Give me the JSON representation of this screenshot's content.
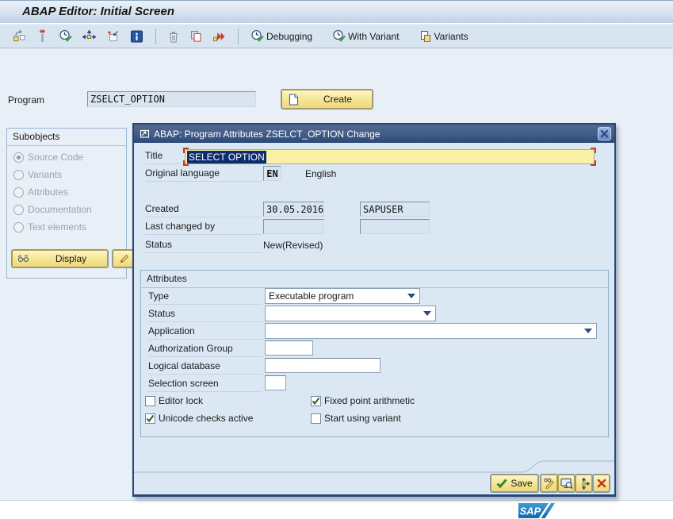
{
  "app": {
    "title": "ABAP Editor: Initial Screen"
  },
  "toolbar": {
    "debugging_label": "Debugging",
    "with_variant_label": "With Variant",
    "variants_label": "Variants",
    "icons": [
      "other-object-icon",
      "create-wand-icon",
      "execute-check-icon",
      "execute-with-icon",
      "insert-icon",
      "info-icon",
      "delete-icon",
      "copy-icon",
      "execute-program-icon",
      "clock-check-icon",
      "variants-icon"
    ]
  },
  "program": {
    "label": "Program",
    "value": "ZSELCT_OPTION",
    "create_label": "Create"
  },
  "subobjects": {
    "title": "Subobjects",
    "options": [
      {
        "label": "Source Code",
        "selected": true
      },
      {
        "label": "Variants",
        "selected": false
      },
      {
        "label": "Attributes",
        "selected": false
      },
      {
        "label": "Documentation",
        "selected": false
      },
      {
        "label": "Text elements",
        "selected": false
      }
    ],
    "display_label": "Display"
  },
  "dialog": {
    "title": "ABAP: Program Attributes ZSELCT_OPTION Change",
    "fields": {
      "title_label": "Title",
      "title_value": "SELECT OPTION",
      "original_language_label": "Original language",
      "original_language_code": "EN",
      "original_language_name": "English",
      "created_label": "Created",
      "created_date": "30.05.2016",
      "created_user": "SAPUSER",
      "last_changed_label": "Last changed by",
      "status_label": "Status",
      "status_value": "New(Revised)"
    },
    "attributes": {
      "title": "Attributes",
      "type_label": "Type",
      "type_value": "Executable program",
      "status_label": "Status",
      "application_label": "Application",
      "authorization_group_label": "Authorization Group",
      "logical_database_label": "Logical database",
      "selection_screen_label": "Selection screen",
      "checkboxes": [
        {
          "label": "Editor lock",
          "checked": false
        },
        {
          "label": "Fixed point arithmetic",
          "checked": true
        },
        {
          "label": "Unicode checks active",
          "checked": true
        },
        {
          "label": "Start using variant",
          "checked": false
        }
      ]
    },
    "footer": {
      "save_label": "Save"
    }
  },
  "brand": {
    "logo_text": "SAP"
  },
  "colors": {
    "accent_yellow": "#F6E694",
    "selection_blue": "#0B2D6F",
    "dialog_border": "#27477A",
    "sap_blue": "#1874BE",
    "title_field_yellow": "#FAF0A6"
  }
}
